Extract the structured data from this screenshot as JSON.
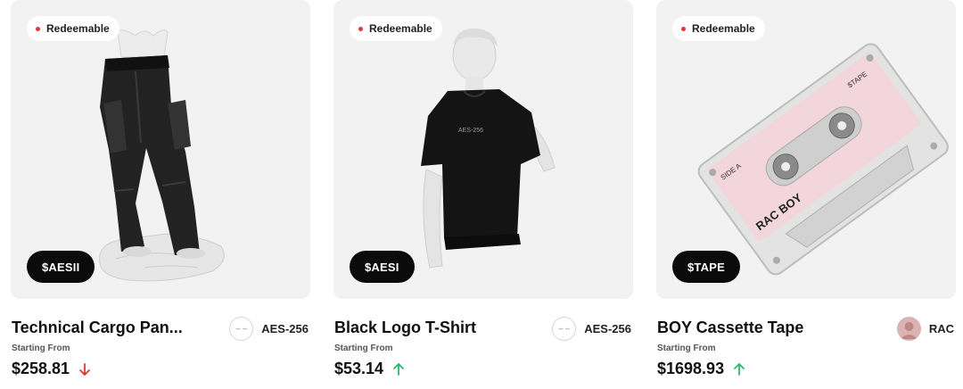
{
  "colors": {
    "up": "#2eb86b",
    "down": "#e2382f",
    "badge_dot": "#e2382f"
  },
  "cards": [
    {
      "badge": "Redeemable",
      "ticker": "$AESII",
      "title": "Technical Cargo Pan...",
      "creator": {
        "name": "AES-256",
        "avatar_icon": "placeholder-avatar-icon",
        "avatar_text": "– –"
      },
      "subtitle": "Starting From",
      "price": "$258.81",
      "trend": "down",
      "image": "cargo-pants-on-statue"
    },
    {
      "badge": "Redeemable",
      "ticker": "$AESI",
      "title": "Black Logo T-Shirt",
      "creator": {
        "name": "AES-256",
        "avatar_icon": "placeholder-avatar-icon",
        "avatar_text": "– –"
      },
      "subtitle": "Starting From",
      "price": "$53.14",
      "trend": "up",
      "image": "tshirt-on-statue-bust"
    },
    {
      "badge": "Redeemable",
      "ticker": "$TAPE",
      "title": "BOY Cassette Tape",
      "creator": {
        "name": "RAC",
        "avatar_icon": "user-photo-avatar",
        "avatar_text": ""
      },
      "subtitle": "Starting From",
      "price": "$1698.93",
      "trend": "up",
      "image": "pink-cassette-tape",
      "cassette_label": {
        "name": "RAC BOY",
        "side": "SIDE A",
        "brand": "$TAPE"
      }
    }
  ]
}
